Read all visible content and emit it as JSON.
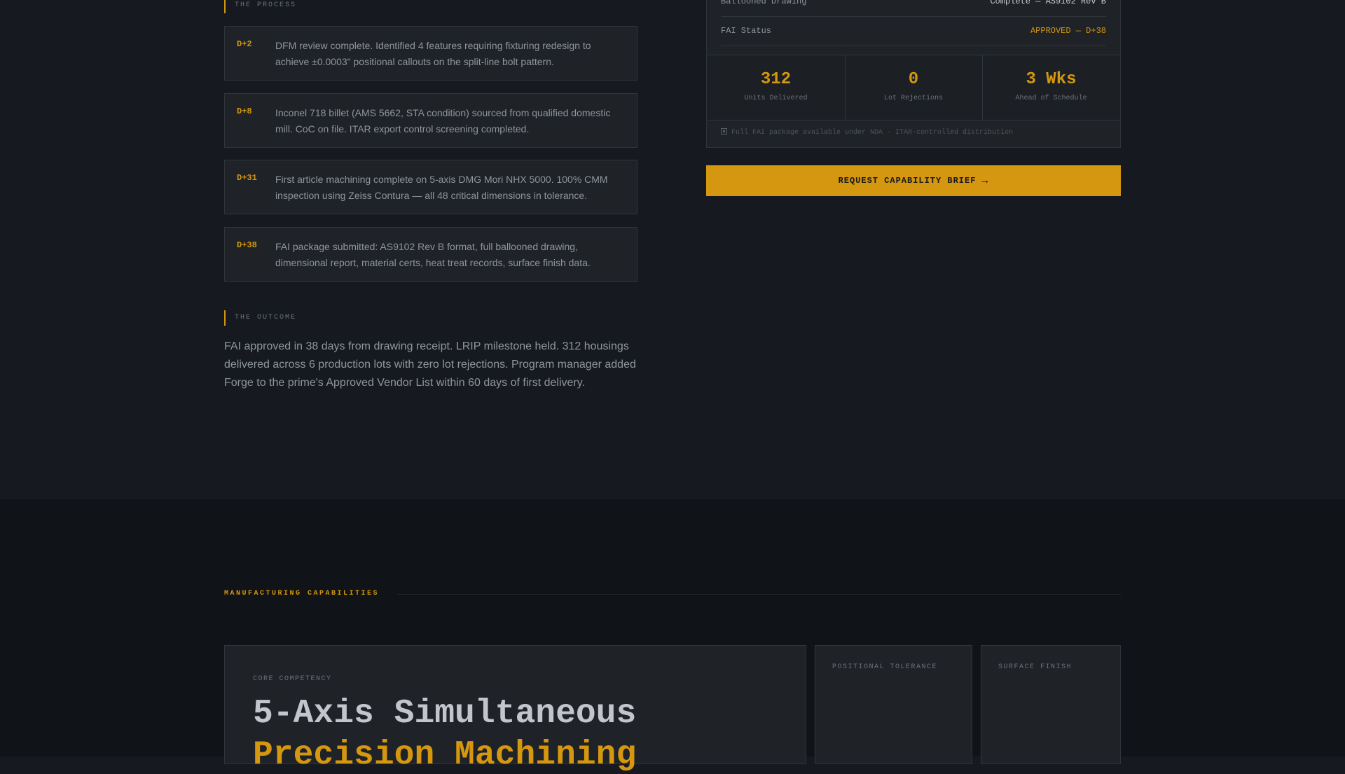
{
  "process": {
    "label": "THE PROCESS",
    "steps": [
      {
        "day": "D+2",
        "text": "DFM review complete. Identified 4 features requiring fixturing redesign to achieve ±0.0003\" positional callouts on the split-line bolt pattern."
      },
      {
        "day": "D+8",
        "text": "Inconel 718 billet (AMS 5662, STA condition) sourced from qualified domestic mill. CoC on file. ITAR export control screening completed."
      },
      {
        "day": "D+31",
        "text": "First article machining complete on 5-axis DMG Mori NHX 5000. 100% CMM inspection using Zeiss Contura — all 48 critical dimensions in tolerance."
      },
      {
        "day": "D+38",
        "text": "FAI package submitted: AS9102 Rev B format, full ballooned drawing, dimensional report, material certs, heat treat records, surface finish data."
      }
    ]
  },
  "outcome": {
    "label": "THE OUTCOME",
    "text": "FAI approved in 38 days from drawing receipt. LRIP milestone held. 312 housings delivered across 6 production lots with zero lot rejections. Program manager added Forge to the prime's Approved Vendor List within 60 days of first delivery."
  },
  "panel": {
    "rows": [
      {
        "key": "Ballooned Drawing",
        "value": "Complete — AS9102 Rev B"
      },
      {
        "key": "FAI Status",
        "value": "APPROVED — D+38"
      }
    ],
    "stats": [
      {
        "value": "312",
        "label": "Units Delivered"
      },
      {
        "value": "0",
        "label": "Lot Rejections"
      },
      {
        "value": "3 Wks",
        "label": "Ahead of Schedule"
      }
    ],
    "note": "Full FAI package available under NDA · ITAR-controlled distribution"
  },
  "cta": {
    "label": "REQUEST CAPABILITY BRIEF",
    "icon": "arrow-right-icon"
  },
  "capabilities": {
    "section_label": "MANUFACTURING CAPABILITIES",
    "main_card": {
      "eyebrow": "CORE COMPETENCY",
      "title_line1": "5-Axis Simultaneous",
      "title_line2": "Precision Machining"
    },
    "side_cards": [
      {
        "label": "POSITIONAL TOLERANCE"
      },
      {
        "label": "SURFACE FINISH"
      }
    ]
  },
  "colors": {
    "accent": "#d4970f",
    "background": "#161a20",
    "card": "#1f2328"
  }
}
